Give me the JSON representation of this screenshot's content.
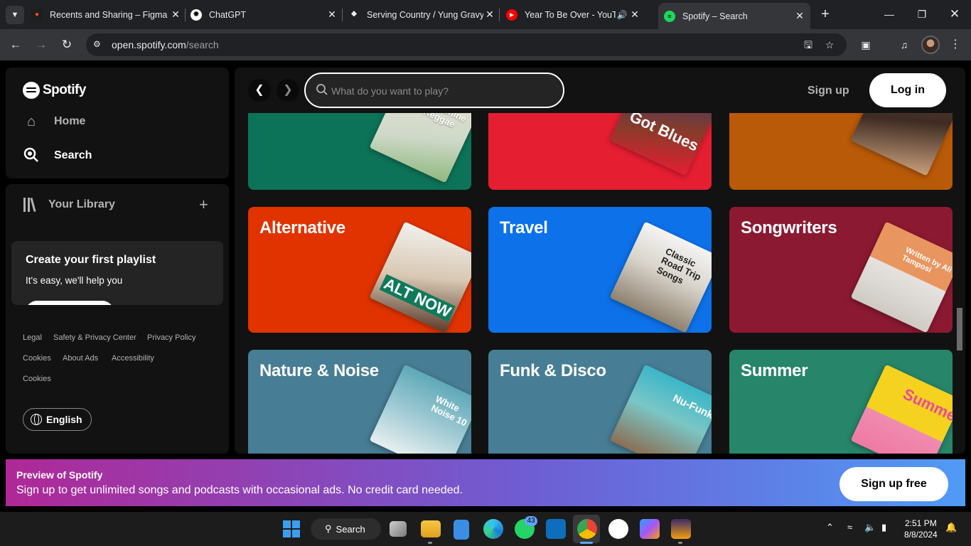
{
  "browser": {
    "tabs": [
      {
        "title": "Recents and Sharing – Figma",
        "icon": "figma-icon"
      },
      {
        "title": "ChatGPT",
        "icon": "chatgpt-icon"
      },
      {
        "title": "Serving Country / Yung Gravy",
        "icon": "tidal-icon"
      },
      {
        "title": "Year To Be Over - YouTube",
        "icon": "youtube-icon"
      },
      {
        "title": "Spotify – Search",
        "icon": "spotify-icon"
      }
    ],
    "url_host": "open.spotify.com",
    "url_path": "/search"
  },
  "sidebar": {
    "brand": "Spotify",
    "nav": {
      "home": "Home",
      "search": "Search"
    },
    "library": {
      "title": "Your Library",
      "create_title": "Create your first playlist",
      "create_sub": "It's easy, we'll help you"
    },
    "footer_links": [
      "Legal",
      "Safety & Privacy Center",
      "Privacy Policy",
      "Cookies",
      "About Ads",
      "Accessibility",
      "Cookies"
    ],
    "language": "English"
  },
  "topbar": {
    "search_placeholder": "What do you want to play?",
    "signup": "Sign up",
    "login": "Log in"
  },
  "categories": {
    "row1": [
      {
        "label": "",
        "color": "#0d7358",
        "art_text": "Sunshine Reggae"
      },
      {
        "label": "",
        "color": "#e61e32",
        "art_text": "Got Blues"
      },
      {
        "label": "",
        "color": "#b95a08",
        "art_text": ""
      }
    ],
    "row2": [
      {
        "label": "Alternative",
        "color": "#e13300",
        "art_text": "ALT NOW"
      },
      {
        "label": "Travel",
        "color": "#0d72ea",
        "art_text": "Classic Road Trip Songs"
      },
      {
        "label": "Songwriters",
        "color": "#8c1932",
        "art_text": "Written by Ali Tamposi"
      }
    ],
    "row3": [
      {
        "label": "Nature & Noise",
        "color": "#477d95",
        "art_text": "White Noise 10"
      },
      {
        "label": "Funk & Disco",
        "color": "#477d95",
        "art_text": "Nu-Funk"
      },
      {
        "label": "Summer",
        "color": "#27856a",
        "art_text": "Summer"
      }
    ]
  },
  "banner": {
    "title": "Preview of Spotify",
    "subtitle": "Sign up to get unlimited songs and podcasts with occasional ads. No credit card needed.",
    "button": "Sign up free"
  },
  "taskbar": {
    "search": "Search",
    "whatsapp_badge": "43",
    "time": "2:51 PM",
    "date": "8/8/2024"
  }
}
